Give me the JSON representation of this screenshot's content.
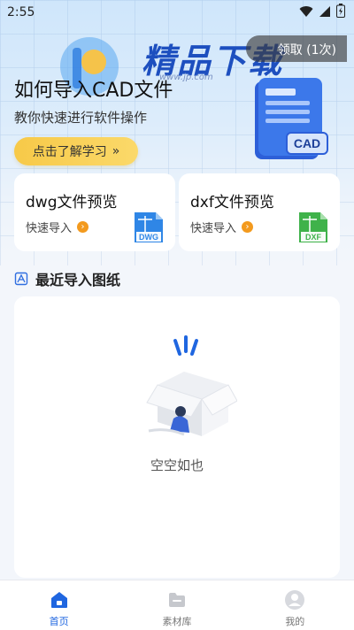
{
  "status_bar": {
    "time": "2:55"
  },
  "watermark": {
    "brand": "精品下载",
    "url": "www.jp.com"
  },
  "coupon": {
    "label": "领取 (1次)"
  },
  "hero": {
    "title": "如何导入CAD文件",
    "subtitle": "教你快速进行软件操作",
    "button_label": "点击了解学习",
    "button_chevron": "»",
    "art_badge": "CAD"
  },
  "cards": [
    {
      "title": "dwg文件预览",
      "link": "快速导入",
      "badge": "DWG",
      "color": "#2f86e6"
    },
    {
      "title": "dxf文件预览",
      "link": "快速导入",
      "badge": "DXF",
      "color": "#3fb24a"
    }
  ],
  "recent": {
    "title": "最近导入图纸",
    "empty_text": "空空如也"
  },
  "nav": [
    {
      "label": "首页",
      "icon": "home-icon",
      "active": true
    },
    {
      "label": "素材库",
      "icon": "folder-icon",
      "active": false
    },
    {
      "label": "我的",
      "icon": "user-icon",
      "active": false
    }
  ],
  "colors": {
    "accent": "#1f66e0",
    "button_yellow": "#f7c948",
    "arrow_orange": "#f39a1e"
  }
}
